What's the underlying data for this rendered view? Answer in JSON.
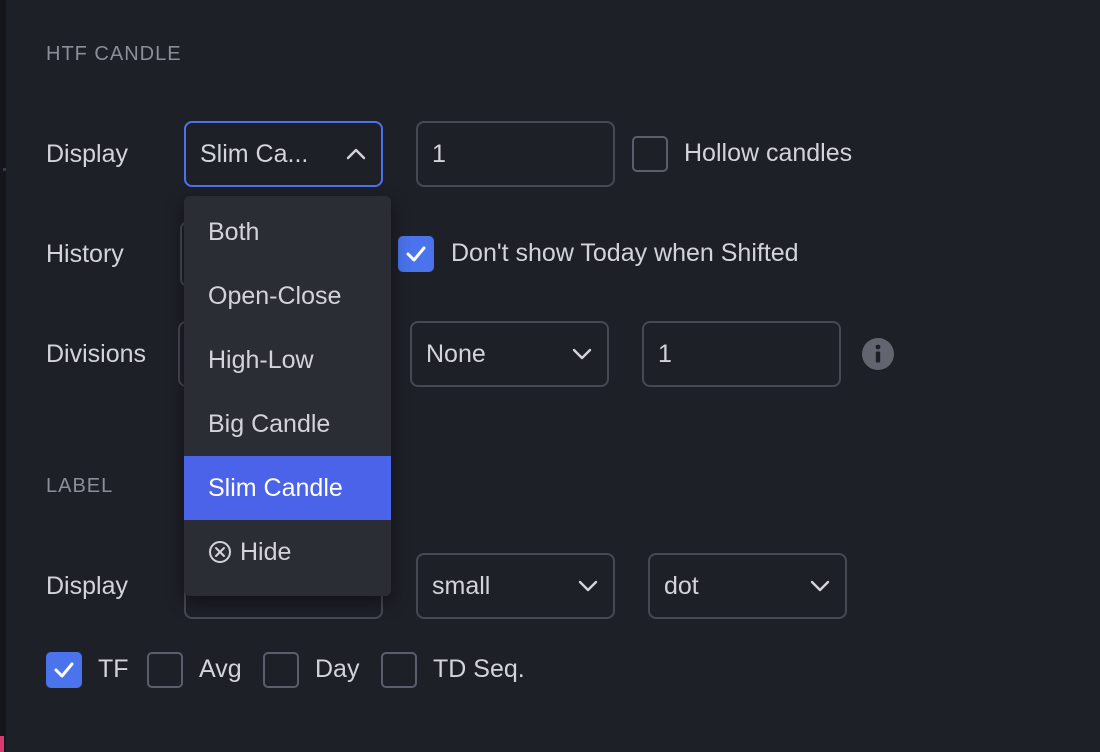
{
  "sections": {
    "htf_candle_title": "HTF CANDLE",
    "label_title": "LABEL"
  },
  "htf": {
    "display_label": "Display",
    "display_value": "Slim Ca...",
    "width_value": "1",
    "hollow_label": "Hollow candles",
    "hollow_checked": false,
    "history_label": "History",
    "dont_show_today_label": "Don't show Today when Shifted",
    "dont_show_today_checked": true,
    "divisions_label": "Divisions",
    "divisions_type_value": "None",
    "divisions_count_value": "1"
  },
  "dropdown": {
    "options": [
      "Both",
      "Open-Close",
      "High-Low",
      "Big Candle",
      "Slim Candle",
      "Hide"
    ],
    "selected": "Slim Candle"
  },
  "label": {
    "display_label": "Display",
    "display_value_partial": "Hide",
    "size_value": "small",
    "style_value": "dot",
    "checks": [
      {
        "label": "TF",
        "checked": true
      },
      {
        "label": "Avg",
        "checked": false
      },
      {
        "label": "Day",
        "checked": false
      },
      {
        "label": "TD Seq.",
        "checked": false
      }
    ]
  },
  "colors": {
    "background": "#1e2028",
    "accent": "#4a73ec",
    "selected_option": "#4a63e8",
    "border": "#464954"
  }
}
